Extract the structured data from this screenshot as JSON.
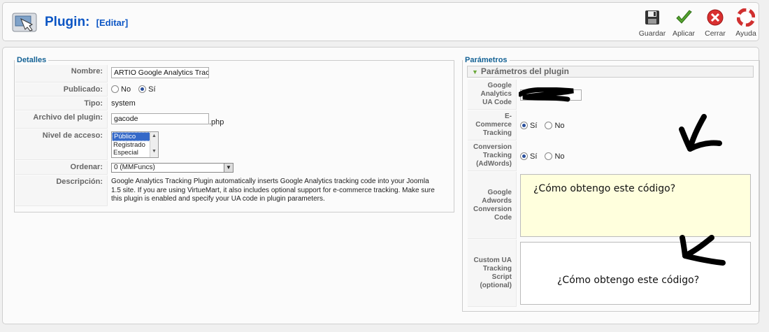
{
  "header": {
    "title": "Plugin:",
    "subtitle": "[Editar]",
    "buttons": [
      {
        "label": "Guardar",
        "icon": "save-icon"
      },
      {
        "label": "Aplicar",
        "icon": "apply-icon"
      },
      {
        "label": "Cerrar",
        "icon": "close-icon"
      },
      {
        "label": "Ayuda",
        "icon": "help-icon"
      }
    ]
  },
  "details": {
    "legend": "Detalles",
    "nombre_label": "Nombre:",
    "nombre_value": "ARTIO Google Analytics Tracking",
    "publicado_label": "Publicado:",
    "publicado_no": "No",
    "publicado_si": "Sí",
    "tipo_label": "Tipo:",
    "tipo_value": "system",
    "archivo_label": "Archivo del plugin:",
    "archivo_value": "gacode",
    "archivo_ext": ".php",
    "nivel_label": "Nivel de acceso:",
    "nivel_options": [
      "Público",
      "Registrado",
      "Especial"
    ],
    "ordenar_label": "Ordenar:",
    "ordenar_value": "0 (MMFuncs)",
    "descripcion_label": "Descripción:",
    "descripcion_value": "Google Analytics Tracking Plugin automatically inserts Google Analytics tracking code into your Joomla 1.5 site. If you are using VirtueMart, it also includes optional support for e-commerce tracking. Make sure this plugin is enabled and specify your UA code in plugin parameters."
  },
  "params": {
    "legend": "Parámetros",
    "panel_title": "Parámetros del plugin",
    "ua_label": "Google Analytics UA Code",
    "ecommerce_label": "E-Commerce Tracking",
    "conversion_label": "Conversion Tracking (AdWords)",
    "si": "Sí",
    "no": "No",
    "adwords_label": "Google Adwords Conversion Code",
    "adwords_note": "¿Cómo obtengo este código?",
    "custom_label": "Custom UA Tracking Script (optional)",
    "custom_note": "¿Cómo obtengo este código?"
  },
  "colors": {
    "title_blue": "#0b55c4",
    "legend_blue": "#146295",
    "adwords_bg": "#ffffdd"
  }
}
